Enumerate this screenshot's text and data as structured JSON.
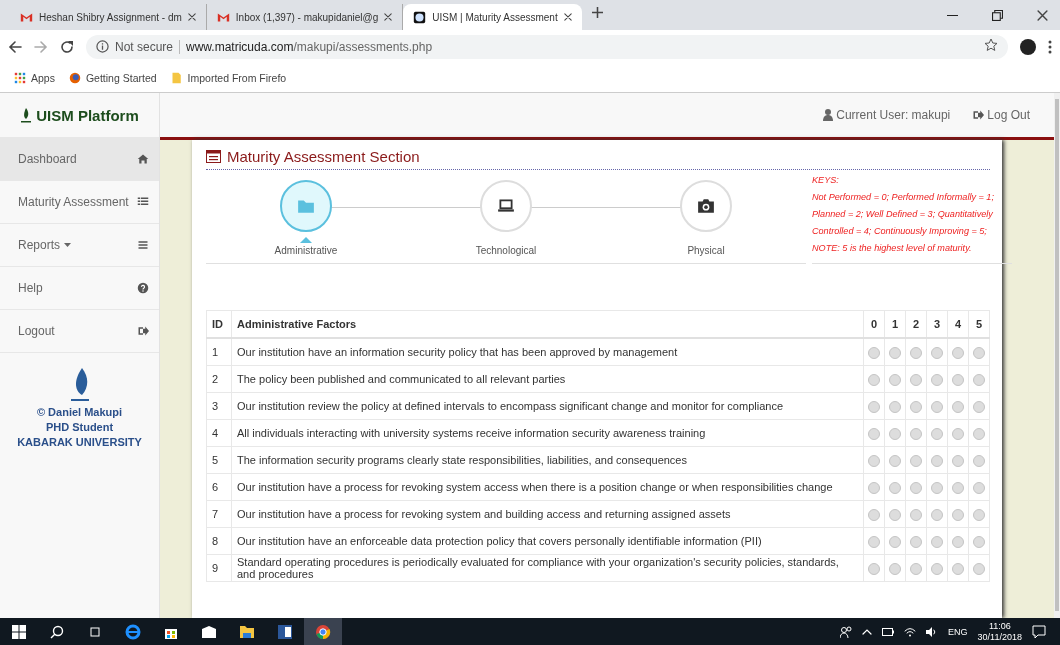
{
  "browser": {
    "tabs": [
      {
        "title": "Heshan Shibry Assignment - dm",
        "selected": false
      },
      {
        "title": "Inbox (1,397) - makupidaniel@g",
        "selected": false
      },
      {
        "title": "UISM | Maturity Assessment",
        "selected": true
      }
    ],
    "address": {
      "security": "Not secure",
      "host": "www.matricuda.com",
      "path": "/makupi/assessments.php"
    },
    "bookmarks": [
      "Apps",
      "Getting Started",
      "Imported From Firefo"
    ]
  },
  "brand": "UISM Platform",
  "header": {
    "user": "Current User: makupi",
    "logout": "Log Out"
  },
  "sidebar": {
    "items": [
      {
        "label": "Dashboard",
        "dropdown": false,
        "selected": true
      },
      {
        "label": "Maturity Assessment",
        "dropdown": false,
        "selected": false
      },
      {
        "label": "Reports",
        "dropdown": true,
        "selected": false
      },
      {
        "label": "Help",
        "dropdown": false,
        "selected": false
      },
      {
        "label": "Logout",
        "dropdown": false,
        "selected": false
      }
    ],
    "credits": [
      "© Daniel Makupi",
      "PHD Student",
      "KABARAK UNIVERSITY"
    ]
  },
  "section": {
    "title": "Maturity Assessment Section",
    "steps": [
      {
        "label": "Administrative",
        "selected": true
      },
      {
        "label": "Technological",
        "selected": false
      },
      {
        "label": "Physical",
        "selected": false
      }
    ],
    "keys": [
      "KEYS:",
      "Not Performed = 0; Performed Informally = 1;",
      "Planned = 2; Well Defined = 3; Quantitatively",
      "Controlled = 4; Continuously Improving = 5;",
      "NOTE: 5 is the highest level of maturity."
    ]
  },
  "table": {
    "columns": [
      "ID",
      "Administrative Factors",
      "0",
      "1",
      "2",
      "3",
      "4",
      "5"
    ],
    "rows": [
      {
        "id": "1",
        "factor": "Our institution have an information security policy that has been approved by management",
        "options": [
          {
            "selected": false
          },
          {
            "selected": false
          },
          {
            "selected": false
          },
          {
            "selected": false
          },
          {
            "selected": false
          },
          {
            "selected": false
          }
        ]
      },
      {
        "id": "2",
        "factor": "The policy been published and communicated to all relevant parties",
        "options": [
          {
            "selected": false
          },
          {
            "selected": false
          },
          {
            "selected": false
          },
          {
            "selected": false
          },
          {
            "selected": false
          },
          {
            "selected": false
          }
        ]
      },
      {
        "id": "3",
        "factor": "Our institution review the policy at defined intervals to encompass significant change and monitor for compliance",
        "options": [
          {
            "selected": false
          },
          {
            "selected": false
          },
          {
            "selected": false
          },
          {
            "selected": false
          },
          {
            "selected": false
          },
          {
            "selected": false
          }
        ]
      },
      {
        "id": "4",
        "factor": "All individuals interacting with university systems receive information security awareness training",
        "options": [
          {
            "selected": false
          },
          {
            "selected": false
          },
          {
            "selected": false
          },
          {
            "selected": false
          },
          {
            "selected": false
          },
          {
            "selected": false
          }
        ]
      },
      {
        "id": "5",
        "factor": "The information security programs clearly state responsibilities, liabilities, and consequences",
        "options": [
          {
            "selected": false
          },
          {
            "selected": false
          },
          {
            "selected": false
          },
          {
            "selected": false
          },
          {
            "selected": false
          },
          {
            "selected": false
          }
        ]
      },
      {
        "id": "6",
        "factor": "Our institution have a process for revoking system access when there is a position change or when responsibilities change",
        "options": [
          {
            "selected": false
          },
          {
            "selected": false
          },
          {
            "selected": false
          },
          {
            "selected": false
          },
          {
            "selected": false
          },
          {
            "selected": false
          }
        ]
      },
      {
        "id": "7",
        "factor": "Our institution have a process for revoking system and building access and returning assigned assets",
        "options": [
          {
            "selected": false
          },
          {
            "selected": false
          },
          {
            "selected": false
          },
          {
            "selected": false
          },
          {
            "selected": false
          },
          {
            "selected": false
          }
        ]
      },
      {
        "id": "8",
        "factor": "Our institution have an enforceable data protection policy that covers personally identifiable information (PII)",
        "options": [
          {
            "selected": false
          },
          {
            "selected": false
          },
          {
            "selected": false
          },
          {
            "selected": false
          },
          {
            "selected": false
          },
          {
            "selected": false
          }
        ]
      },
      {
        "id": "9",
        "factor": "Standard operating procedures is periodically evaluated for compliance with your organization's security policies, standards, and procedures",
        "options": [
          {
            "selected": false
          },
          {
            "selected": false
          },
          {
            "selected": false
          },
          {
            "selected": false
          },
          {
            "selected": false
          },
          {
            "selected": false
          }
        ]
      }
    ]
  },
  "taskbar": {
    "language": "ENG",
    "time": "11:06",
    "date": "30/11/2018"
  }
}
